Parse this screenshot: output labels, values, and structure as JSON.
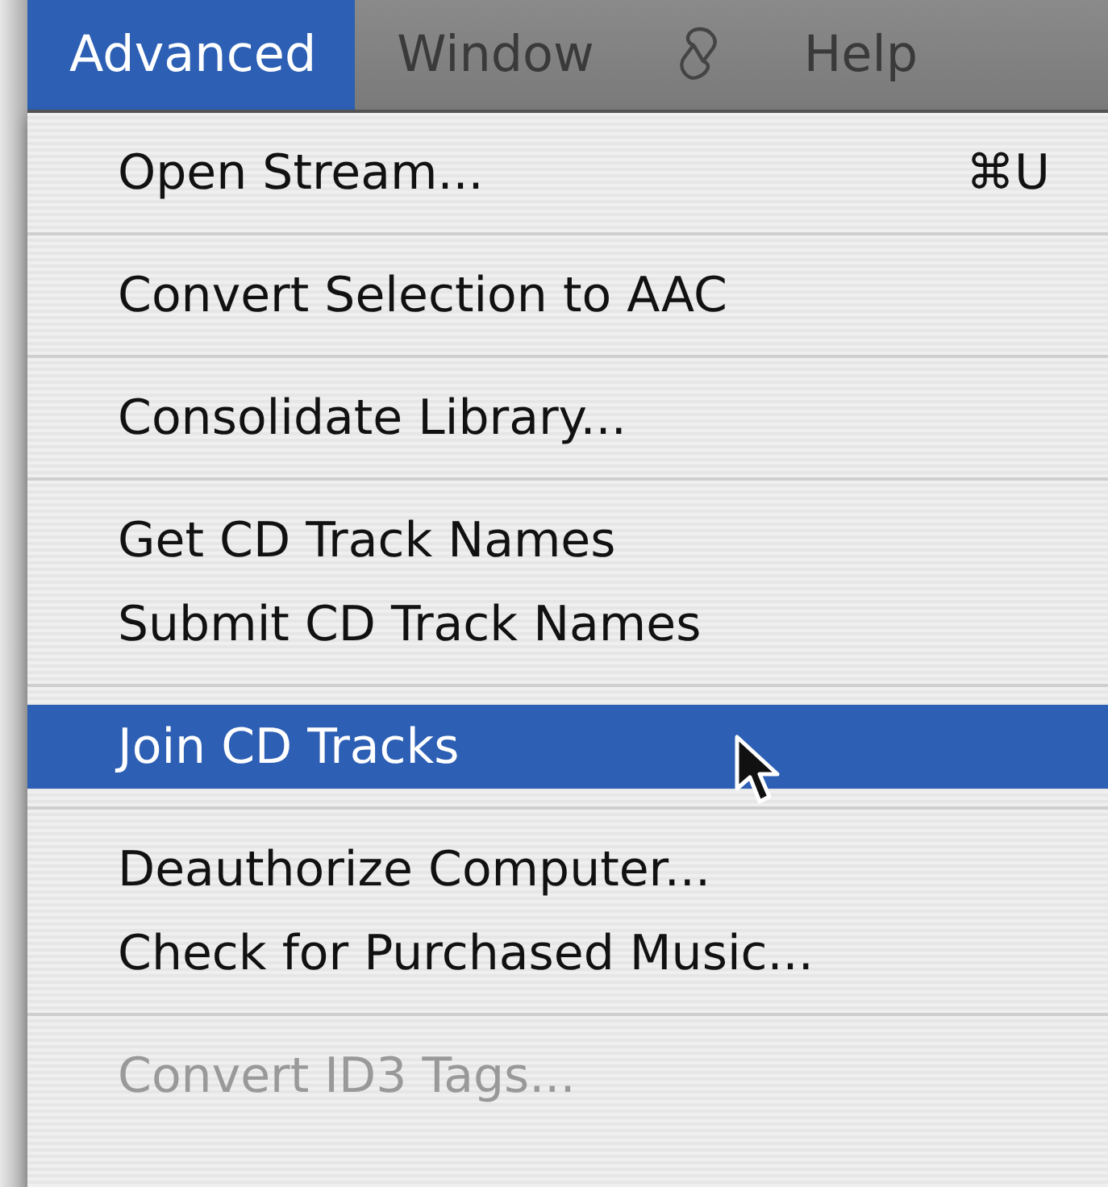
{
  "menu_bar": [
    {
      "label": "Advanced",
      "kind": "text",
      "selected": true
    },
    {
      "label": "Window",
      "kind": "text",
      "selected": false
    },
    {
      "kind": "script",
      "selected": false
    },
    {
      "label": "Help",
      "kind": "text",
      "selected": false
    }
  ],
  "menu": {
    "groups": [
      [
        {
          "label": "Open Stream...",
          "shortcut": "⌘U",
          "selected": false,
          "disabled": false
        }
      ],
      [
        {
          "label": "Convert Selection to AAC",
          "selected": false,
          "disabled": false
        }
      ],
      [
        {
          "label": "Consolidate Library...",
          "selected": false,
          "disabled": false
        }
      ],
      [
        {
          "label": "Get CD Track Names",
          "selected": false,
          "disabled": false
        },
        {
          "label": "Submit CD Track Names",
          "selected": false,
          "disabled": false
        }
      ],
      [
        {
          "label": "Join CD Tracks",
          "selected": true,
          "disabled": false
        }
      ],
      [
        {
          "label": "Deauthorize Computer...",
          "selected": false,
          "disabled": false
        },
        {
          "label": "Check for Purchased Music...",
          "selected": false,
          "disabled": false
        }
      ],
      [
        {
          "label": "Convert ID3 Tags...",
          "selected": false,
          "disabled": true
        }
      ]
    ]
  }
}
